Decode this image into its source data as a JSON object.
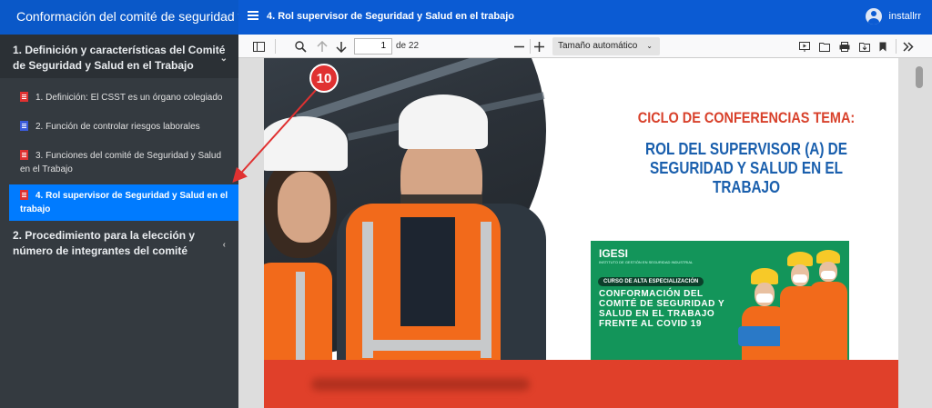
{
  "header": {
    "course_title": "Conformación del comité de seguridad y ...",
    "lesson_title": "4. Rol supervisor de Seguridad y Salud en el trabajo",
    "user_name": "installrr"
  },
  "sidebar": {
    "section1_title": "1. Definición y características del Comité de Seguridad y Salud en el Trabajo",
    "section1_chevron": "⌄",
    "items": [
      {
        "label": "1. Definición: El CSST es un órgano colegiado",
        "icon": "pdf-icon"
      },
      {
        "label": "2. Función de controlar riesgos laborales",
        "icon": "word-icon"
      },
      {
        "label": "3. Funciones del comité de Seguridad y Salud en el Trabajo",
        "icon": "pdf-icon"
      },
      {
        "label": "4. Rol supervisor de Seguridad y Salud en el trabajo",
        "icon": "pdf-icon",
        "active": true
      }
    ],
    "section2_title": "2. Procedimiento para la elección y número de integrantes del comité",
    "section2_chevron": "‹"
  },
  "pdf_toolbar": {
    "page_number": "1",
    "page_of": "de 22",
    "zoom": "Tamaño automático",
    "zoom_dropdown": "⌄"
  },
  "pdf_page": {
    "conference": "CICLO DE CONFERENCIAS TEMA:",
    "topic": "ROL DEL SUPERVISOR (A) DE SEGURIDAD Y SALUD EN EL TRABAJO",
    "brand": "IGESI",
    "brand_sub": "INSTITUTO DE GESTIÓN EN SEGURIDAD INDUSTRIAL",
    "course_badge": "CURSO DE ALTA ESPECIALIZACIÓN",
    "course_title": "CONFORMACIÓN DEL COMITÉ DE SEGURIDAD Y SALUD EN EL TRABAJO FRENTE AL COVID 19"
  },
  "annotation": {
    "step_number": "10",
    "color": "#e03131"
  },
  "colors": {
    "topbar": "#0b5bd3",
    "sidebar": "#343a40",
    "active_item": "#007bff",
    "headline_red": "#d8412b",
    "headline_blue": "#1a5fad",
    "course_green": "#13955a"
  }
}
